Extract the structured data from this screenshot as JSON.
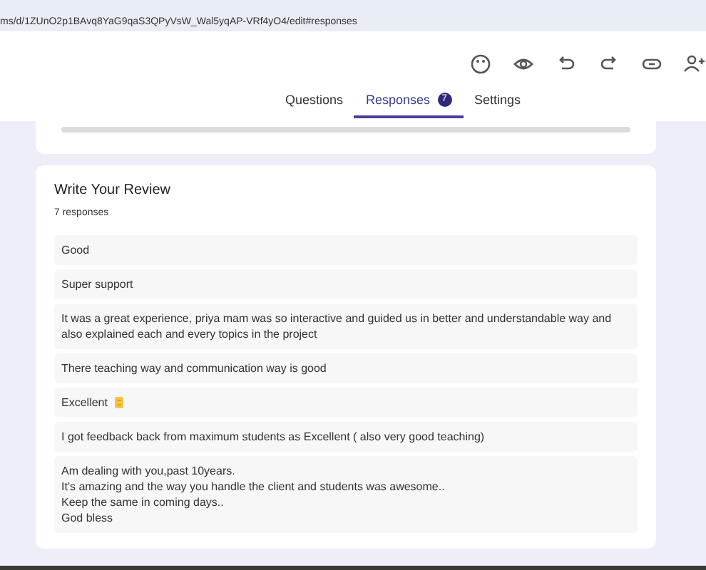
{
  "address_bar": {
    "url": "ms/d/1ZUnO2p1BAvq8YaG9qaS3QPyVsW_Wal5yqAP-VRf4yO4/edit#responses"
  },
  "tabs": [
    {
      "label": "Questions",
      "selected": false
    },
    {
      "label": "Responses",
      "selected": true,
      "badge": "7"
    },
    {
      "label": "Settings",
      "selected": false
    }
  ],
  "question": {
    "title": "Write Your Review",
    "count": "7 responses"
  },
  "responses": [
    {
      "text": "Good"
    },
    {
      "text": "Super support"
    },
    {
      "text": "It was a great experience, priya mam was so interactive and guided us in better and understandable way and also explained each and every topics in the project"
    },
    {
      "text": "There teaching way and communication way is good"
    },
    {
      "text": "Excellent",
      "emoji": true
    },
    {
      "text": "I got feedback back from maximum students as Excellent ( also very good teaching)"
    },
    {
      "text": "Am dealing with you,past 10years.\nIt's amazing and the way you handle the client and students was awesome..\nKeep the same in coming days..\nGod bless"
    }
  ]
}
